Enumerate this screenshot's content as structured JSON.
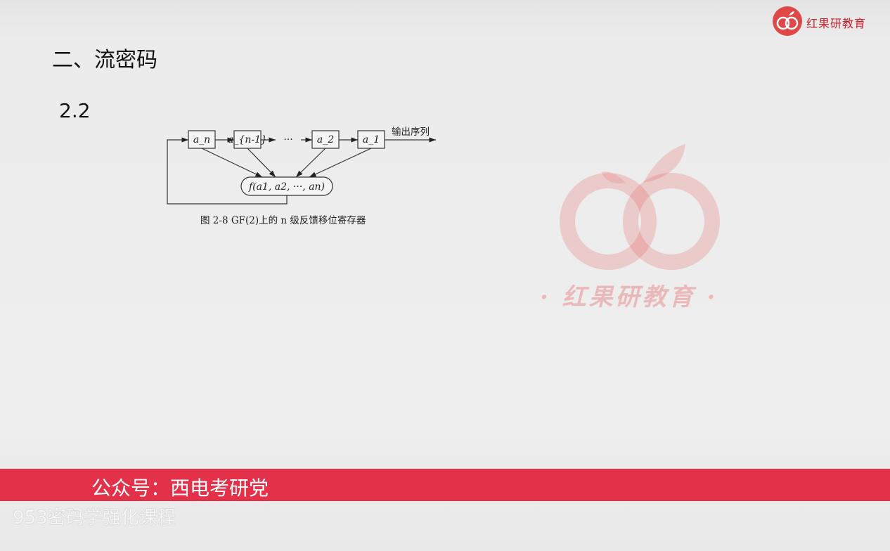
{
  "slide": {
    "title": "二、流密码",
    "section": "2.2"
  },
  "logo": {
    "text": "红果研教育"
  },
  "watermark": {
    "text": "· 红果研教育 ·"
  },
  "figure": {
    "registers": [
      "a_n",
      "a_{n-1}",
      "a_2",
      "a_1"
    ],
    "ellipsis": "···",
    "output_label": "输出序列",
    "function_label": "f(a1, a2, ···, an)",
    "caption": "图 2-8   GF(2)上的 n 级反馈移位寄存器"
  },
  "banner": {
    "text": "公众号：西电考研党"
  },
  "course": {
    "text": "953密码学强化课程"
  },
  "colors": {
    "banner": "#e3314a",
    "logo": "#c8232e"
  }
}
